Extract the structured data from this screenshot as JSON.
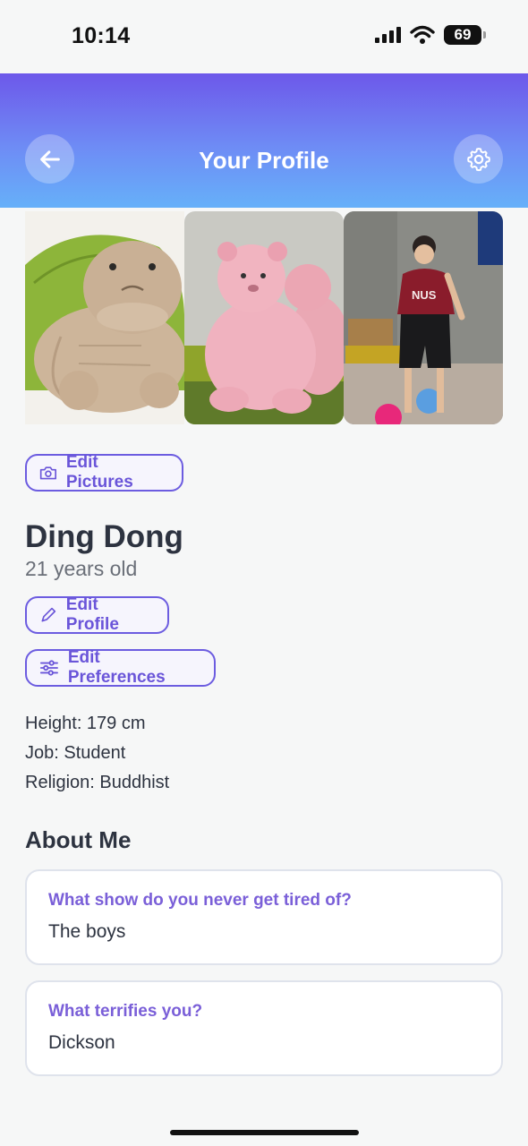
{
  "status_bar": {
    "time": "10:14",
    "battery": "69"
  },
  "header": {
    "title": "Your Profile",
    "back_icon": "arrow-left-icon",
    "settings_icon": "gear-icon"
  },
  "photos": [
    {
      "subject": "turtle plush toy"
    },
    {
      "subject": "pink bear plush toys"
    },
    {
      "subject": "person in NUS shirt"
    }
  ],
  "photo_text": {
    "shirt_logo": "NUS"
  },
  "actions": {
    "edit_pictures": "Edit Pictures",
    "edit_profile": "Edit Profile",
    "edit_preferences": "Edit Preferences"
  },
  "profile": {
    "name": "Ding Dong",
    "age": "21 years old",
    "height": "Height: 179 cm",
    "job": "Job: Student",
    "religion": "Religion: Buddhist"
  },
  "about": {
    "title": "About Me",
    "items": [
      {
        "question": "What show do you never get tired of?",
        "answer": "The boys"
      },
      {
        "question": "What terrifies you?",
        "answer": "Dickson"
      }
    ]
  },
  "colors": {
    "accent": "#6a55d9",
    "header_top": "#6d58ea",
    "header_bottom": "#66b0f9",
    "background": "#f6f7f7"
  }
}
